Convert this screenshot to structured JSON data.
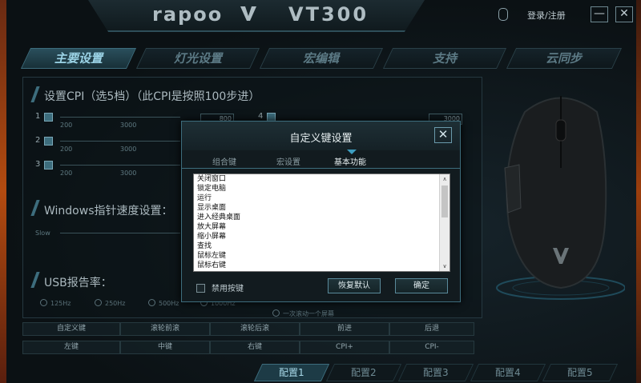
{
  "app": {
    "brand": "rapoo",
    "model": "VT300",
    "login": "登录/注册",
    "minimize": "—",
    "close": "✕"
  },
  "main_tabs": [
    "主要设置",
    "灯光设置",
    "宏编辑",
    "支持",
    "云同步"
  ],
  "dpi": {
    "title": "设置CPI（选5档）（此CPI是按照100步进）",
    "rows": [
      {
        "num": "1",
        "min": "200",
        "mid": "3000",
        "val": "800"
      },
      {
        "num": "2",
        "min": "200",
        "mid": "3000",
        "val": ""
      },
      {
        "num": "3",
        "min": "200",
        "mid": "3000",
        "val": ""
      }
    ],
    "right_row": {
      "num": "4",
      "val": "3000"
    }
  },
  "pointer": {
    "title": "Windows指针速度设置：",
    "slow": "Slow"
  },
  "usb": {
    "title": "USB报告率：",
    "options": [
      "125Hz",
      "250Hz",
      "500Hz",
      "1000Hz"
    ],
    "scroll_note": "一次滚动一个屏幕"
  },
  "button_grid": [
    [
      "自定义键",
      "滚轮前滚",
      "滚轮后滚",
      "前进",
      "后退"
    ],
    [
      "左键",
      "中键",
      "右键",
      "CPI+",
      "CPI-"
    ]
  ],
  "configs": [
    "配置1",
    "配置2",
    "配置3",
    "配置4",
    "配置5"
  ],
  "dialog": {
    "title": "自定义键设置",
    "close": "✕",
    "tabs": [
      "组合键",
      "宏设置",
      "基本功能"
    ],
    "active_tab": "基本功能",
    "items": [
      "关闭窗口",
      "锁定电脑",
      "运行",
      "显示桌面",
      "进入经典桌面",
      "放大屏幕",
      "缩小屏幕",
      "查找",
      "鼠标左键",
      "鼠标右键"
    ],
    "scroll_up": "∧",
    "scroll_down": "∨",
    "disable_label": "禁用按键",
    "reset_button": "恢复默认",
    "ok_button": "确定"
  }
}
